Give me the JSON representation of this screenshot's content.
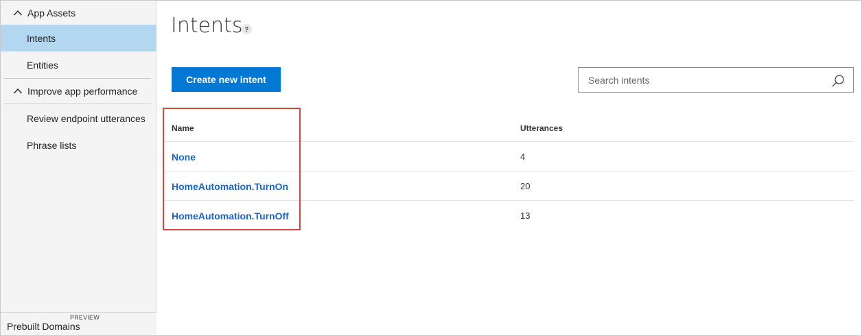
{
  "sidebar": {
    "sections": [
      {
        "label": "App Assets",
        "items": [
          {
            "label": "Intents",
            "active": true
          },
          {
            "label": "Entities",
            "active": false
          }
        ]
      },
      {
        "label": "Improve app performance",
        "items": [
          {
            "label": "Review endpoint utterances",
            "active": false
          },
          {
            "label": "Phrase lists",
            "active": false
          }
        ]
      }
    ],
    "footer": {
      "badge": "PREVIEW",
      "label": "Prebuilt Domains"
    }
  },
  "main": {
    "title": "Intents",
    "help_label": "?",
    "create_button_label": "Create new intent",
    "search": {
      "placeholder": "Search intents",
      "value": ""
    },
    "table": {
      "columns": [
        "Name",
        "Utterances"
      ],
      "rows": [
        {
          "name": "None",
          "utterances": "4"
        },
        {
          "name": "HomeAutomation.TurnOn",
          "utterances": "20"
        },
        {
          "name": "HomeAutomation.TurnOff",
          "utterances": "13"
        }
      ]
    }
  },
  "colors": {
    "accent": "#0078d4",
    "link": "#1a66c8",
    "active_nav": "#b3d7f0",
    "highlight_border": "#d9453a"
  },
  "icons": {
    "collapse": "chevron-up-icon",
    "help": "help-icon",
    "search": "search-icon"
  }
}
